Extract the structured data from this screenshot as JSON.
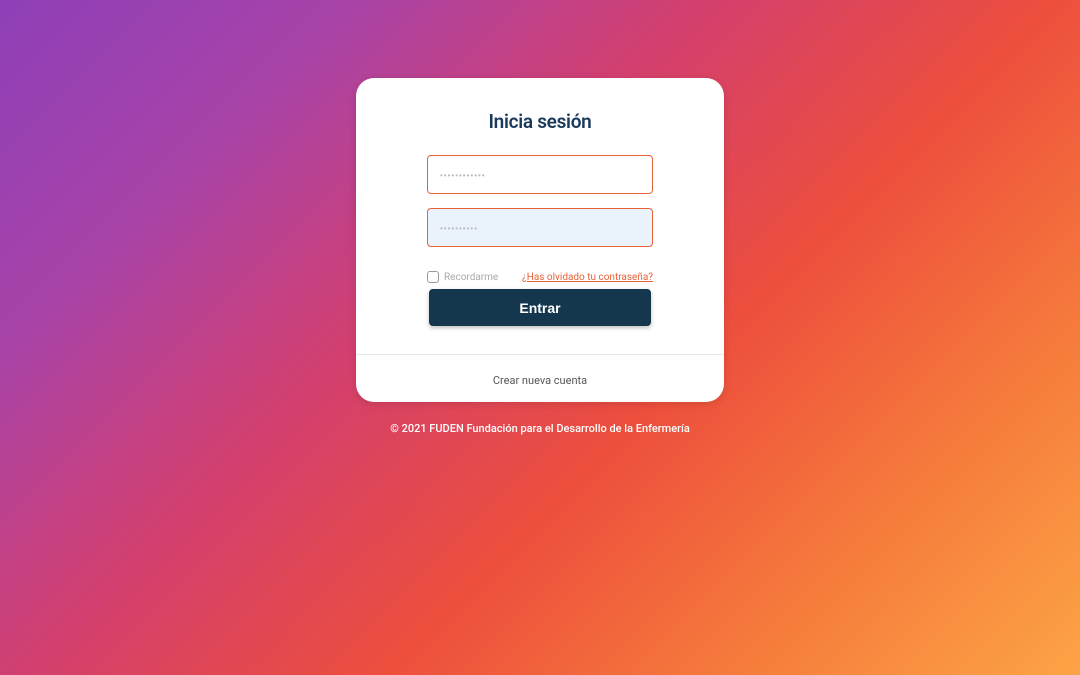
{
  "login": {
    "title": "Inicia sesión",
    "username_placeholder": "••••••••••••",
    "password_placeholder": "••••••••••",
    "remember_label": "Recordarme",
    "forgot_password_text": "¿Has olvidado tu contraseña?",
    "submit_label": "Entrar",
    "create_account_text": "Crear nueva cuenta"
  },
  "footer": {
    "copyright": "© 2021 FUDEN Fundación para el Desarrollo de la Enfermería"
  }
}
